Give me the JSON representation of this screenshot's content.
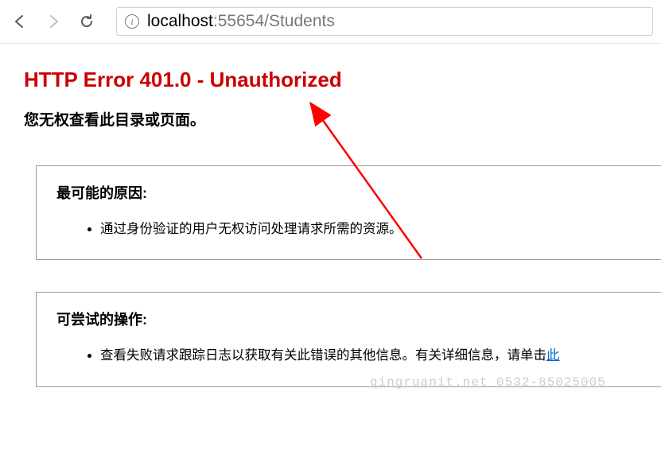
{
  "browser": {
    "url_host": "localhost",
    "url_port": ":55654",
    "url_path": "/Students"
  },
  "error": {
    "title": "HTTP Error 401.0 - Unauthorized",
    "subtitle": "您无权查看此目录或页面。"
  },
  "section1": {
    "title": "最可能的原因:",
    "item1": "通过身份验证的用户无权访问处理请求所需的资源。"
  },
  "section2": {
    "title": "可尝试的操作:",
    "item1_a": "查看失败请求跟踪日志以获取有关此错误的其他信息。有关详细信息，请单击",
    "item1_link": "此"
  },
  "watermark": "qingruanit.net 0532-85025005"
}
